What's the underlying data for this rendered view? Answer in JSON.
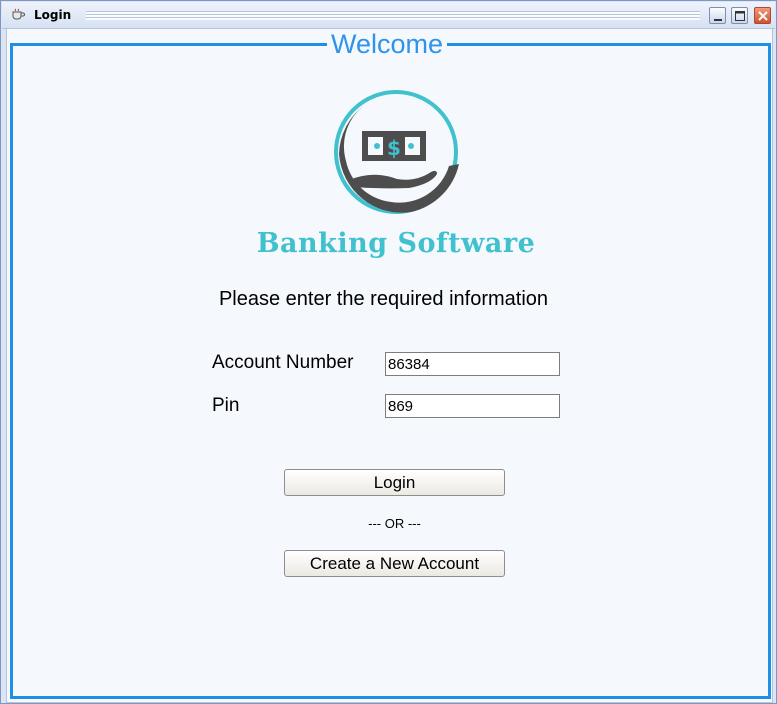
{
  "window": {
    "title": "Login"
  },
  "panel": {
    "legend": "Welcome"
  },
  "brand": {
    "name": "Banking Software",
    "logo_symbol": "$",
    "color": "#40c1cd"
  },
  "form": {
    "instructions": "Please enter the required information",
    "account_number_label": "Account Number",
    "account_number_value": "86384",
    "pin_label": "Pin",
    "pin_value": "869",
    "login_label": "Login",
    "separator": "--- OR ---",
    "create_account_label": "Create a New Account"
  },
  "colors": {
    "accent": "#1f8fe3",
    "legend_text": "#2f93ea",
    "background": "#f5f9fe"
  }
}
